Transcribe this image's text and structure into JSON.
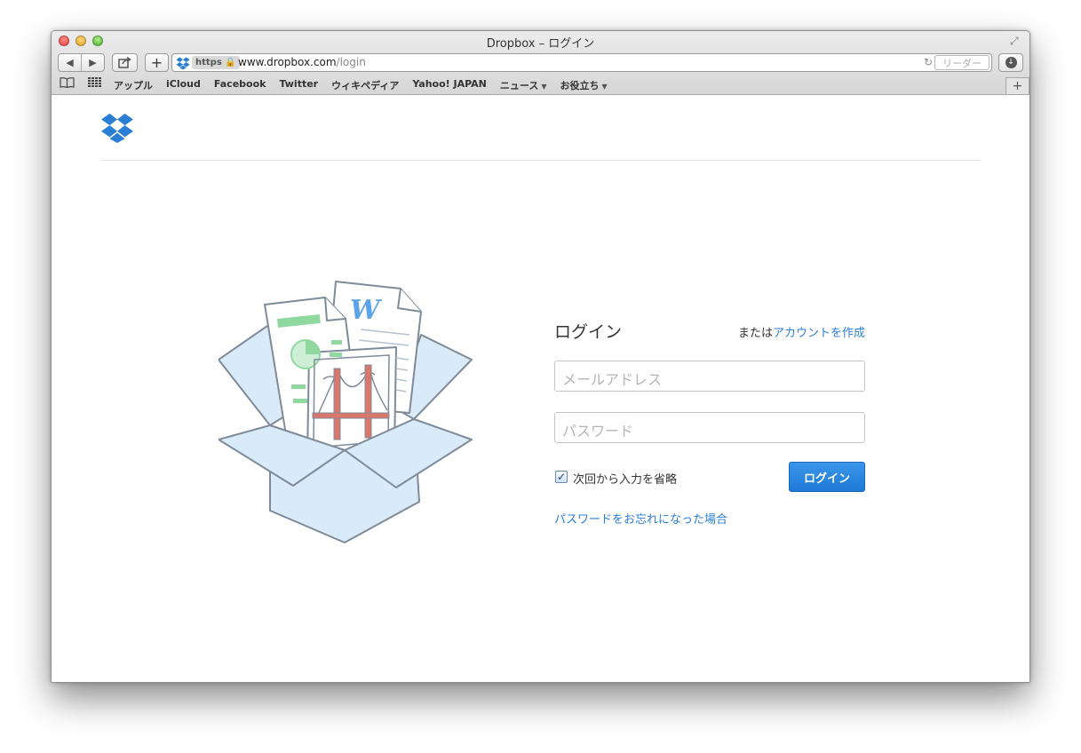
{
  "window": {
    "title": "Dropbox – ログイン"
  },
  "toolbar": {
    "back_icon": "◀",
    "forward_icon": "▶",
    "add_icon": "+",
    "https_label": "https",
    "url_domain": "www.dropbox.com",
    "url_path": "/login",
    "reader_label": "リーダー"
  },
  "bookmarks": {
    "items": [
      "アップル",
      "iCloud",
      "Facebook",
      "Twitter",
      "ウィキペディア",
      "Yahoo! JAPAN",
      "ニュース",
      "お役立ち"
    ],
    "new_tab_icon": "+"
  },
  "login": {
    "title": "ログイン",
    "or_label": "または",
    "create_account_link": "アカウントを作成",
    "email_placeholder": "メールアドレス",
    "password_placeholder": "パスワード",
    "remember_label": "次回から入力を省略",
    "remember_checked": true,
    "login_button": "ログイン",
    "forgot_password_link": "パスワードをお忘れになった場合"
  },
  "colors": {
    "accent": "#2a7fd4",
    "dropbox_blue": "#2a7fd4",
    "button_blue": "#1e7ad8"
  },
  "icons": {
    "logo": "dropbox-logo-icon",
    "favicon": "dropbox-favicon-icon",
    "lock": "lock-icon",
    "reload": "reload-icon",
    "download": "download-icon",
    "share": "share-icon",
    "reading_list": "book-icon",
    "top_sites": "grid-icon"
  }
}
